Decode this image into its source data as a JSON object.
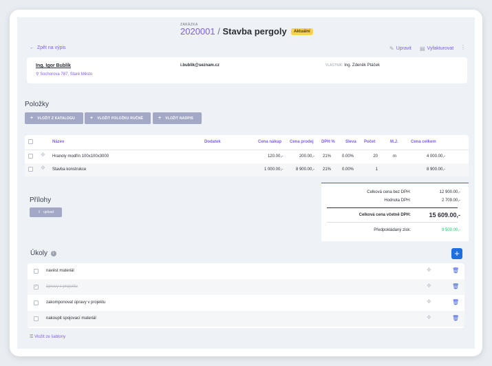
{
  "header": {
    "eyebrow": "ZAKÁZKA",
    "number": "2020001",
    "separator": "/",
    "title": "Stavba pergoly",
    "status": "Aktuální"
  },
  "nav": {
    "back": "Zpět na výpis",
    "edit": "Upravit",
    "invoice": "Vyfakturovat"
  },
  "customer": {
    "name": "Ing. Igor Bublík",
    "address": "Sochorova 787, Staré Město",
    "email": "i.bublik@seznam.cz",
    "owner_label": "VLASTNÍK:",
    "owner": "Ing. Zdeněk Ptáček"
  },
  "items": {
    "heading": "Položky",
    "buttons": [
      "VLOŽIT Z KATALOGU",
      "VLOŽIT POLOŽKU RUČNĚ",
      "VLOŽIT NADPIS"
    ],
    "columns": [
      "Název",
      "Dodatek",
      "Cena nákup",
      "Cena prodej",
      "DPH %",
      "Sleva",
      "Počet",
      "M.J.",
      "Cena celkem"
    ],
    "rows": [
      {
        "name": "Hranoly modřín 100x100x3000",
        "extra": "",
        "buy": "120.00,-",
        "sell": "200.00,-",
        "vat": "21%",
        "discount": "0.00%",
        "qty": "20",
        "unit": "m",
        "total": "4 000.00,-"
      },
      {
        "name": "Stavba konstrukce",
        "extra": "",
        "buy": "1 000.00,-",
        "sell": "8 900.00,-",
        "vat": "21%",
        "discount": "0.00%",
        "qty": "1",
        "unit": "",
        "total": "8 900.00,-"
      }
    ]
  },
  "totals": {
    "without_vat_label": "Celková cena bez DPH:",
    "without_vat": "12 900.00,-",
    "vat_label": "Hodnota DPH:",
    "vat": "2 709.00,-",
    "with_vat_label": "Celková cena včetně DPH:",
    "with_vat": "15 609.00,-",
    "profit_label": "Předpokládaný zisk:",
    "profit": "9 500.00,-"
  },
  "attachments": {
    "heading": "Přílohy",
    "upload": "upload"
  },
  "tasks": {
    "heading": "Úkoly",
    "items": [
      {
        "text": "navést materiál",
        "done": false
      },
      {
        "text": "úpravy v projektu",
        "done": true
      },
      {
        "text": "zakomponovat úpravy v projektu",
        "done": false
      },
      {
        "text": "nakoupit spojovací materiál",
        "done": false
      }
    ],
    "template_link": "Vložit ze šablony"
  },
  "colors": {
    "accent": "#7d5cf1",
    "primary": "#1d6fe0",
    "badge": "#fbd24e",
    "profit": "#2fc36a"
  }
}
